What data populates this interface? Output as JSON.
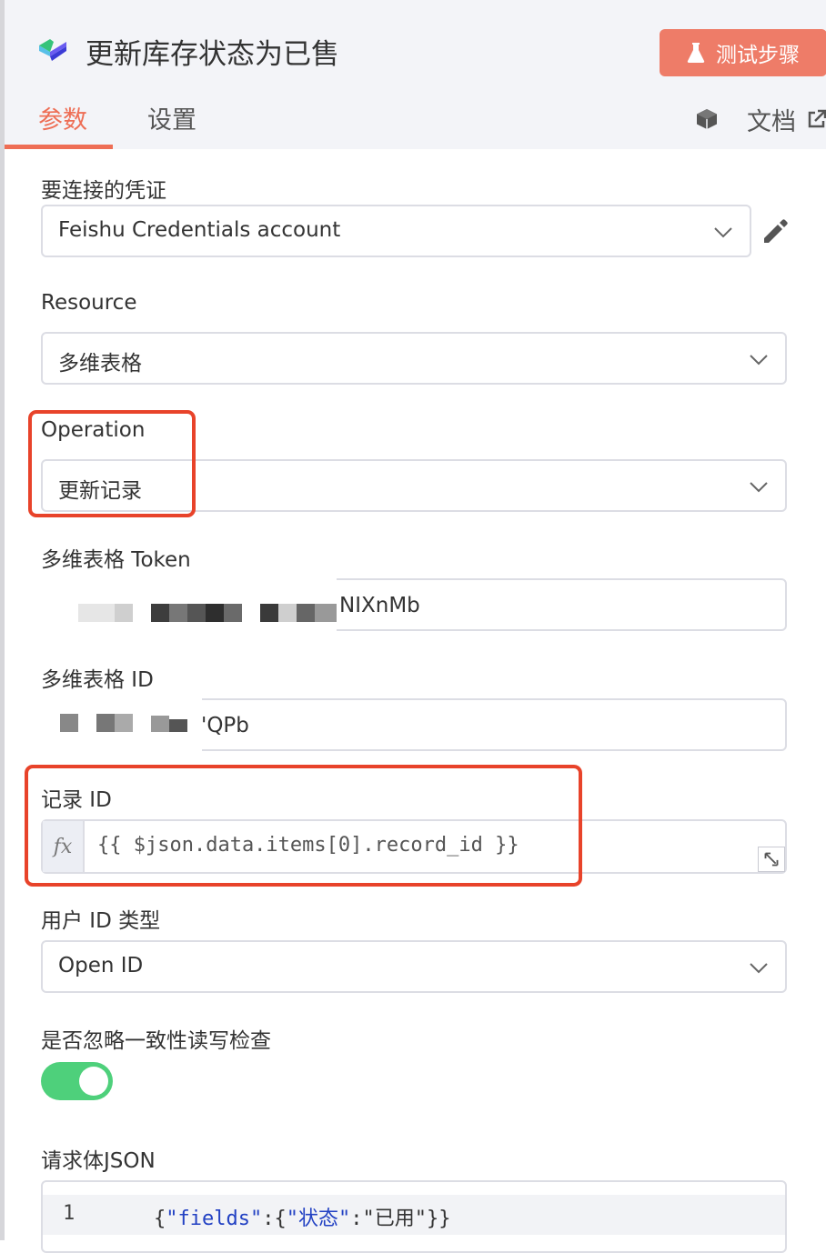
{
  "header": {
    "title": "更新库存状态为已售",
    "test_button_label": "测试步骤",
    "tabs": [
      {
        "label": "参数",
        "active": true
      },
      {
        "label": "设置",
        "active": false
      }
    ],
    "docs_label": "文档"
  },
  "fields": {
    "credential": {
      "label": "要连接的凭证",
      "value": "Feishu Credentials account"
    },
    "resource": {
      "label": "Resource",
      "value": "多维表格"
    },
    "operation": {
      "label": "Operation",
      "value": "更新记录"
    },
    "app_token": {
      "label": "多维表格 Token",
      "visible_value": "NIXnMb"
    },
    "table_id": {
      "label": "多维表格 ID",
      "visible_value": "'QPb"
    },
    "record_id": {
      "label": "记录 ID",
      "fx_label": "fx",
      "expression": "{{ $json.data.items[0].record_id }}"
    },
    "user_id_type": {
      "label": "用户 ID 类型",
      "value": "Open ID"
    },
    "ignore_consistency": {
      "label": "是否忽略一致性读写检查",
      "enabled": true
    },
    "request_body": {
      "label": "请求体JSON",
      "line_number": "1",
      "code_parts": [
        "{",
        "\"fields\"",
        ":{",
        "\"状态\"",
        ":",
        "\"已用\"",
        "}}"
      ]
    }
  },
  "colors": {
    "accent": "#ee6e55",
    "test_button": "#ee7c68",
    "highlight_box": "#e8432a",
    "toggle_on": "#4ed07b",
    "json_string": "#2241c3"
  },
  "icons": [
    "n8n-logo-icon",
    "flask-icon",
    "cube-icon",
    "external-link-icon",
    "chevron-down-icon",
    "pencil-icon",
    "expand-icon"
  ]
}
